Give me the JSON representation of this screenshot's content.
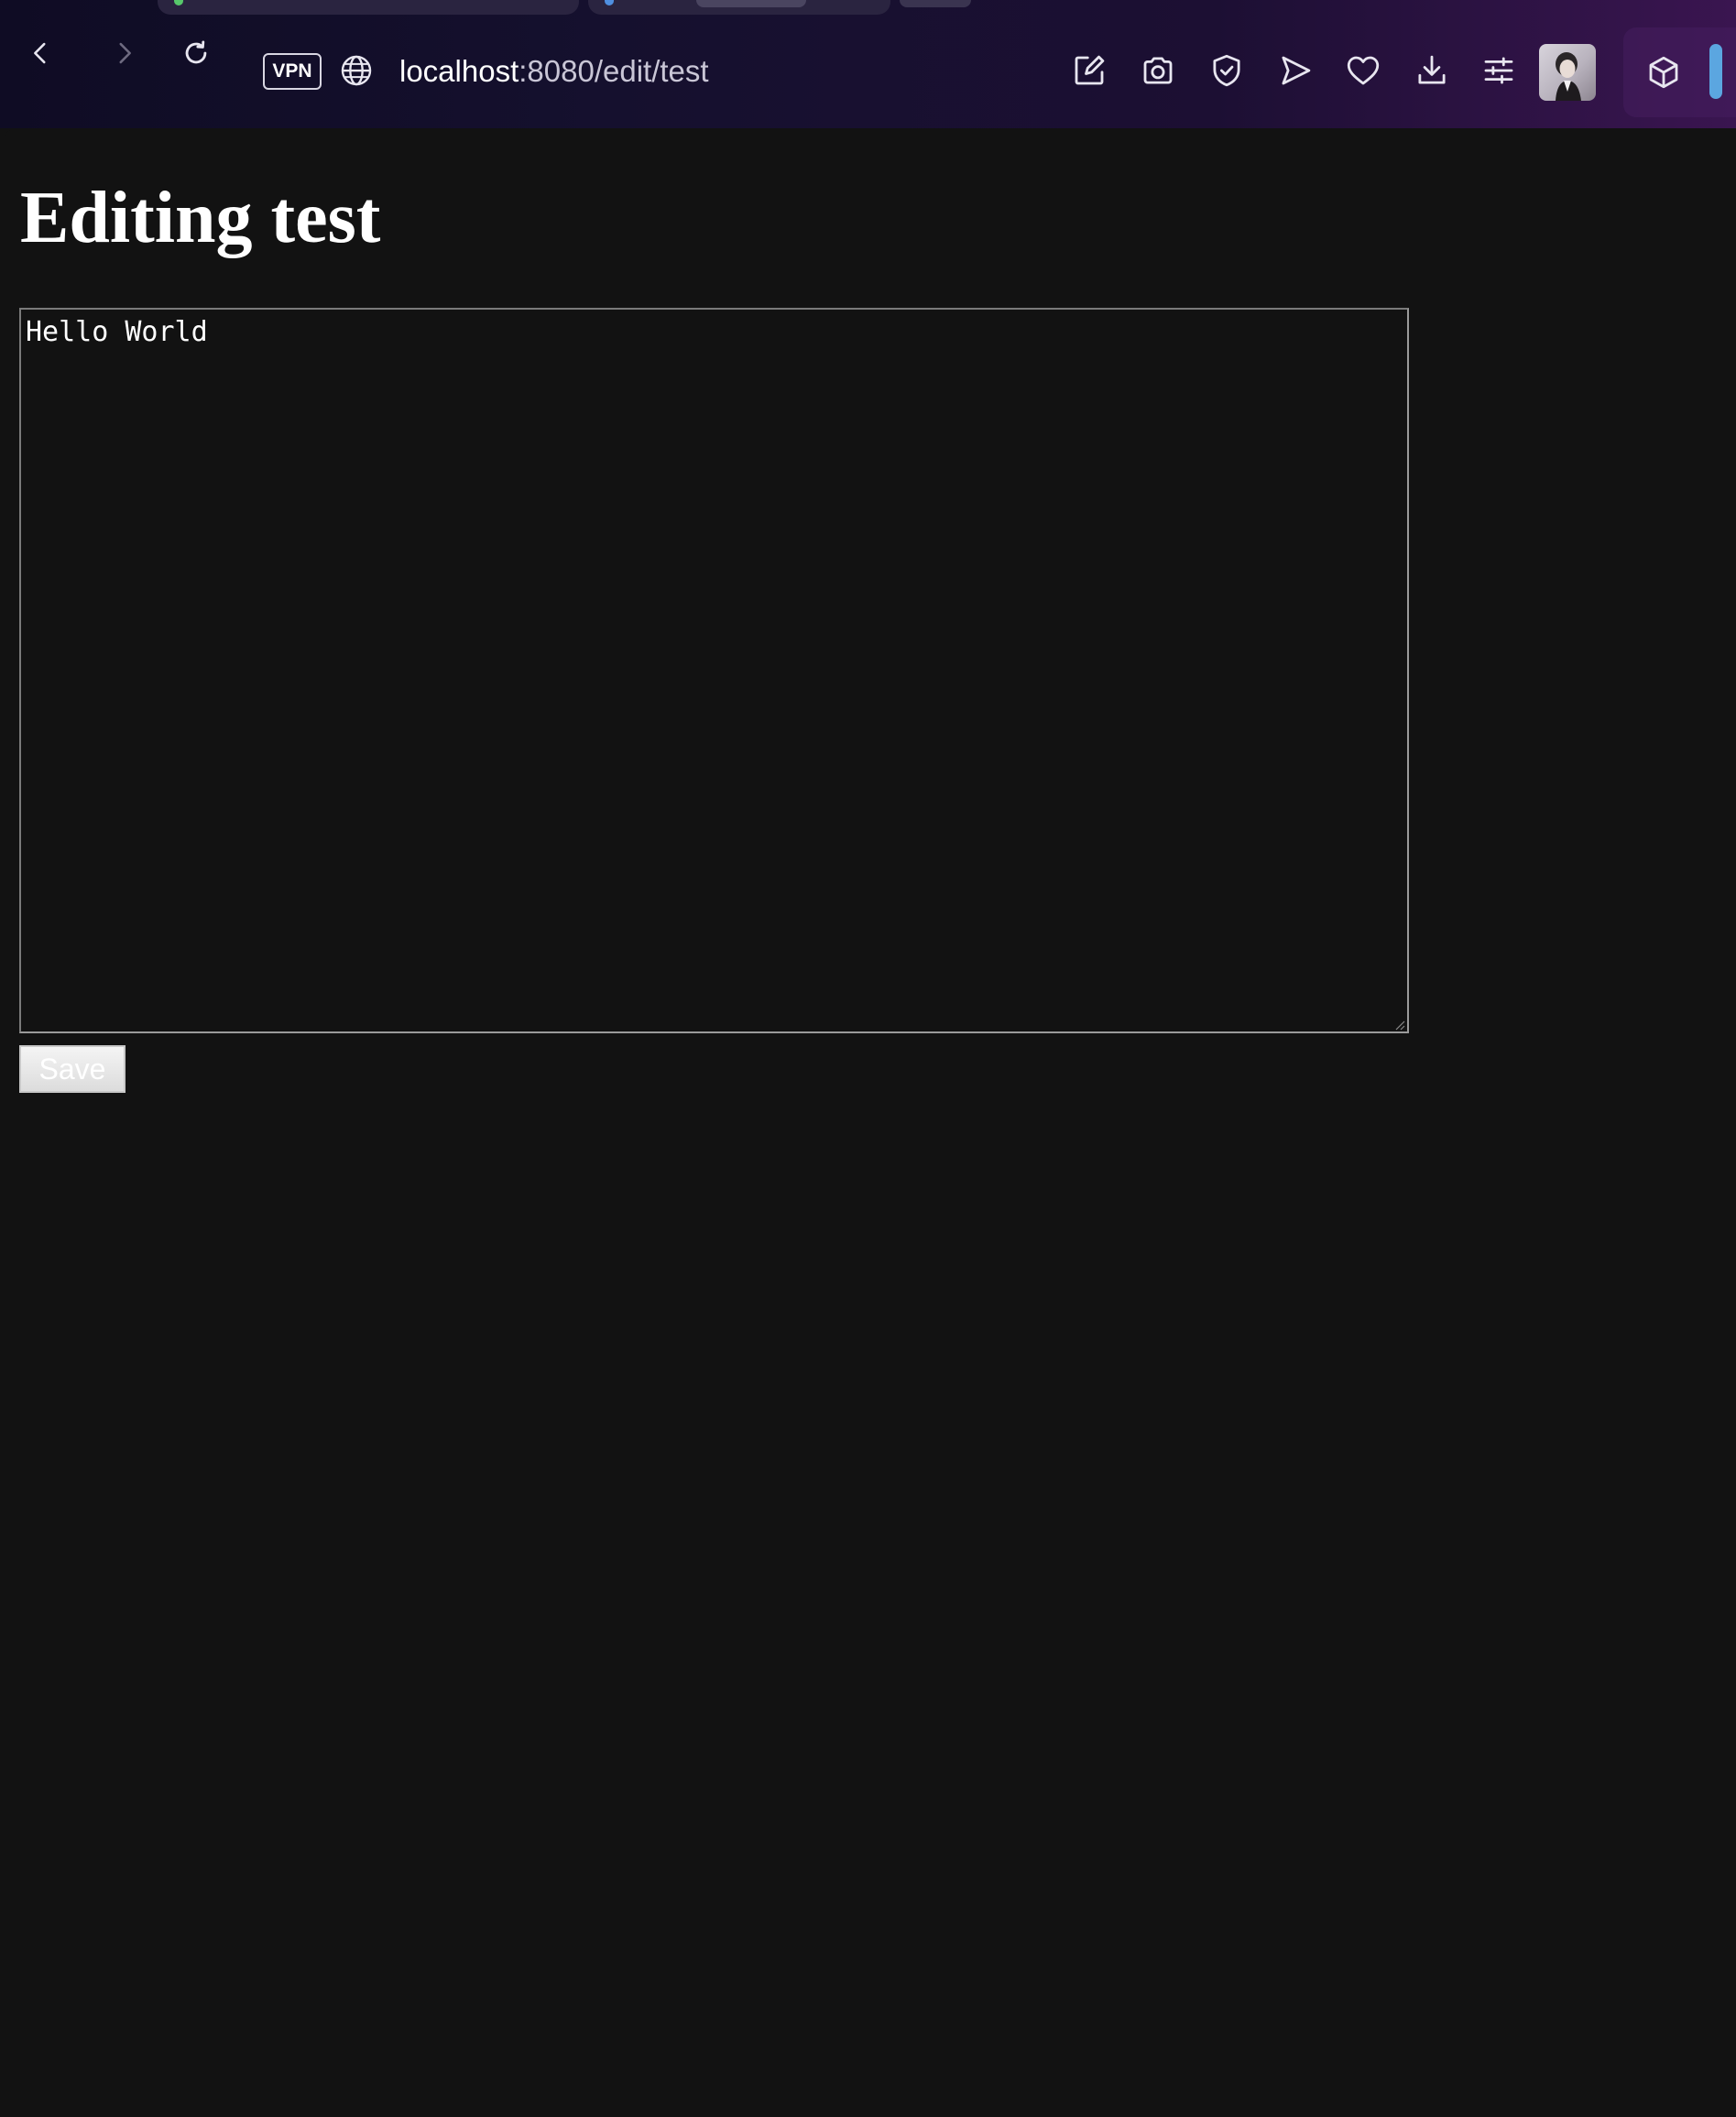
{
  "browser": {
    "vpn_label": "VPN",
    "url_host": "localhost",
    "url_path": ":8080/edit/test",
    "icons": {
      "back": "chevron-left-icon",
      "forward": "chevron-right-icon",
      "reload": "reload-icon",
      "site_info": "globe-icon",
      "toolbar": [
        "share-edit-icon",
        "camera-icon",
        "shield-check-icon",
        "send-icon",
        "heart-icon",
        "download-icon",
        "sliders-icon",
        "cube-icon"
      ]
    },
    "colors": {
      "chrome_start": "#0f0c24",
      "chrome_end": "#3a1550",
      "sidebar_handle": "#5ba6e0"
    }
  },
  "page": {
    "title": "Editing test",
    "textarea_value": "Hello World",
    "save_label": "Save",
    "colors": {
      "background": "#121212",
      "text": "#ffffff"
    }
  }
}
